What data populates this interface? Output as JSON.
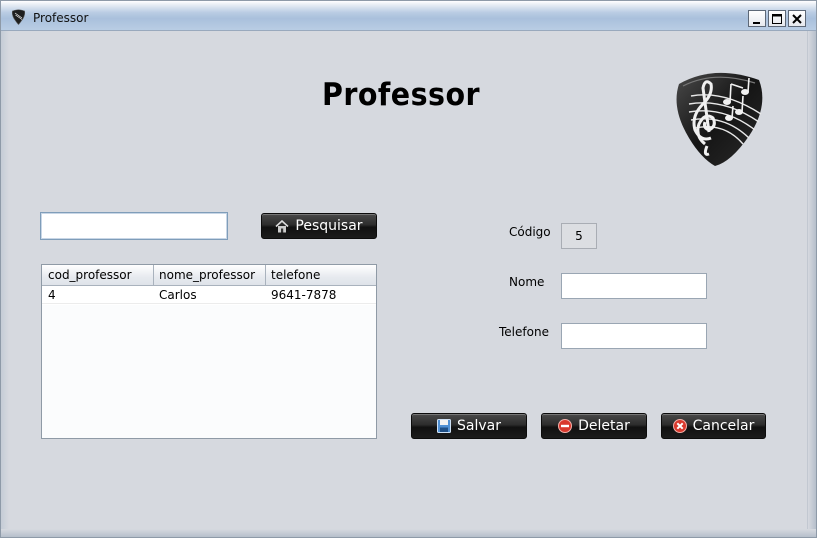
{
  "window": {
    "title": "Professor",
    "controls": {
      "minimize": "minimize-icon",
      "maximize": "maximize-icon",
      "close": "close-icon"
    }
  },
  "header": {
    "title": "Professor",
    "logo": "guitar-pick-music-icon"
  },
  "search": {
    "value": "",
    "button_label": "Pesquisar",
    "button_icon": "house-icon"
  },
  "table": {
    "columns": [
      "cod_professor",
      "nome_professor",
      "telefone"
    ],
    "rows": [
      [
        "4",
        "Carlos",
        "9641-7878"
      ]
    ]
  },
  "form": {
    "codigo": {
      "label": "Código",
      "value": "5"
    },
    "nome": {
      "label": "Nome",
      "value": ""
    },
    "telefone": {
      "label": "Telefone",
      "value": ""
    }
  },
  "actions": {
    "save": {
      "label": "Salvar",
      "icon": "floppy-disk-icon"
    },
    "delete": {
      "label": "Deletar",
      "icon": "minus-circle-icon"
    },
    "cancel": {
      "label": "Cancelar",
      "icon": "x-circle-icon"
    }
  },
  "colors": {
    "window_bg": "#d6d9df",
    "titlebar": "#b9cce3",
    "button_dark": "#1b1b1b",
    "delete_red": "#d9382c",
    "save_blue": "#4f8fd3"
  }
}
